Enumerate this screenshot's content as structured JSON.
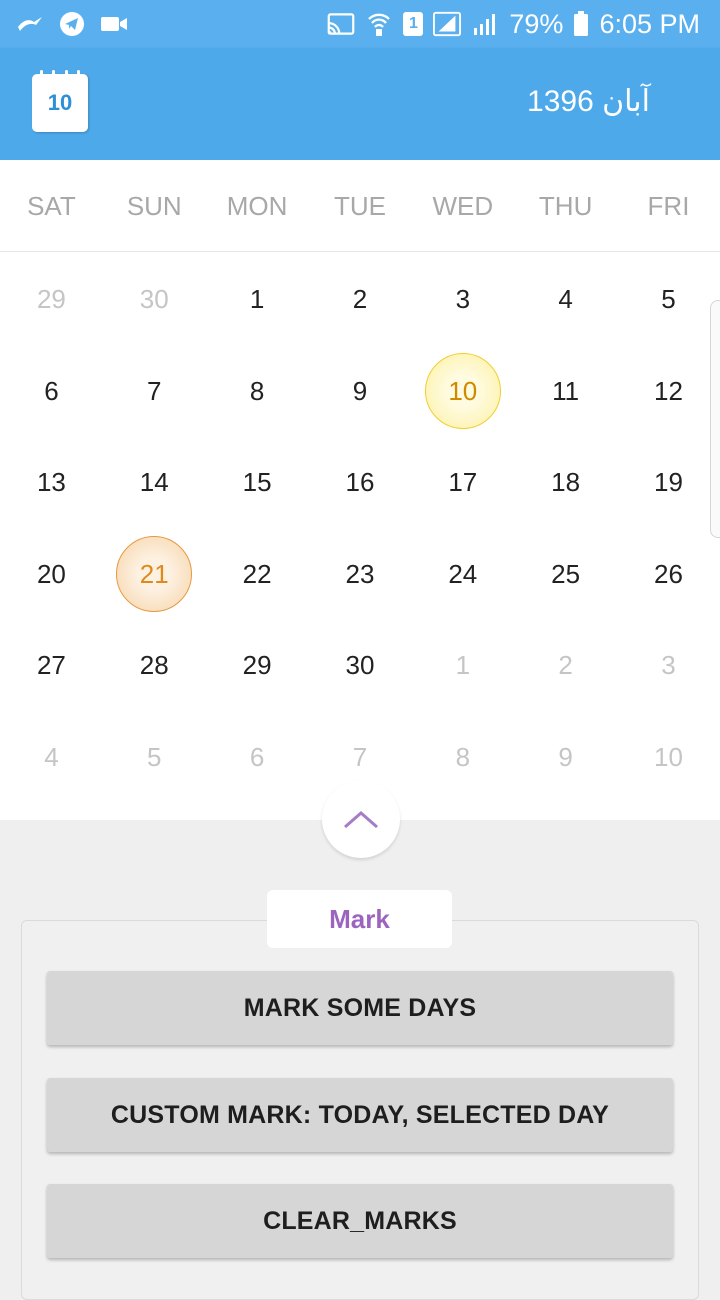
{
  "status_bar": {
    "battery": "79%",
    "time": "6:05 PM",
    "sim_badge": "1",
    "icons": [
      "zello-icon",
      "telegram-icon",
      "video-icon",
      "cast-icon",
      "wifi-icon",
      "sim-icon",
      "signal-icon",
      "signal-icon-2",
      "battery-icon"
    ]
  },
  "app_bar": {
    "calendar_day": "10",
    "title": "آبان 1396"
  },
  "weekdays": [
    "SAT",
    "SUN",
    "MON",
    "TUE",
    "WED",
    "THU",
    "FRI"
  ],
  "weeks": [
    [
      {
        "n": "29",
        "muted": true
      },
      {
        "n": "30",
        "muted": true
      },
      {
        "n": "1"
      },
      {
        "n": "2"
      },
      {
        "n": "3"
      },
      {
        "n": "4"
      },
      {
        "n": "5"
      }
    ],
    [
      {
        "n": "6"
      },
      {
        "n": "7"
      },
      {
        "n": "8"
      },
      {
        "n": "9"
      },
      {
        "n": "10",
        "state": "today"
      },
      {
        "n": "11"
      },
      {
        "n": "12"
      }
    ],
    [
      {
        "n": "13"
      },
      {
        "n": "14"
      },
      {
        "n": "15"
      },
      {
        "n": "16"
      },
      {
        "n": "17"
      },
      {
        "n": "18"
      },
      {
        "n": "19"
      }
    ],
    [
      {
        "n": "20"
      },
      {
        "n": "21",
        "state": "selected"
      },
      {
        "n": "22"
      },
      {
        "n": "23"
      },
      {
        "n": "24"
      },
      {
        "n": "25"
      },
      {
        "n": "26"
      }
    ],
    [
      {
        "n": "27"
      },
      {
        "n": "28"
      },
      {
        "n": "29"
      },
      {
        "n": "30"
      },
      {
        "n": "1",
        "muted": true
      },
      {
        "n": "2",
        "muted": true
      },
      {
        "n": "3",
        "muted": true
      }
    ],
    [
      {
        "n": "4",
        "muted": true
      },
      {
        "n": "5",
        "muted": true
      },
      {
        "n": "6",
        "muted": true
      },
      {
        "n": "7",
        "muted": true
      },
      {
        "n": "8",
        "muted": true
      },
      {
        "n": "9",
        "muted": true
      },
      {
        "n": "10",
        "muted": true
      }
    ]
  ],
  "mark": {
    "label": "Mark",
    "buttons": [
      "MARK SOME DAYS",
      "CUSTOM MARK: TODAY, SELECTED DAY",
      "CLEAR_MARKS"
    ]
  },
  "colors": {
    "status_bar": "#5ab0ef",
    "app_bar": "#4da9ea",
    "today_fill": "#fdf0a0",
    "today_text": "#d08a00",
    "selected_fill": "#f6d3a6",
    "selected_text": "#e08a1e",
    "mark_label": "#9c64bf"
  }
}
